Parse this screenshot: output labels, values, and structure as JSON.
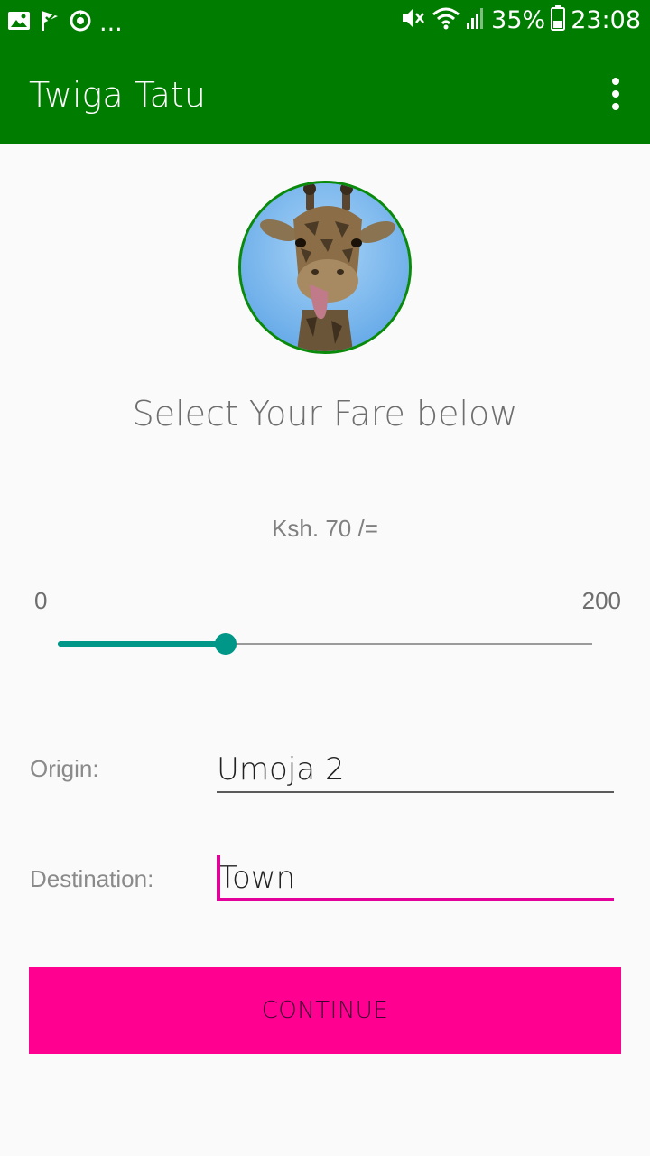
{
  "status_bar": {
    "left_icons": [
      "gallery-icon",
      "checkmark-flag-icon",
      "sync-icon",
      "more-notifications-icon"
    ],
    "more_text": "...",
    "right_icons": [
      "mute-icon",
      "wifi-icon",
      "signal-icon",
      "battery-icon"
    ],
    "battery": "35%",
    "time": "23:08"
  },
  "app_bar": {
    "title": "Twiga Tatu",
    "menu_icon": "overflow-menu-icon"
  },
  "avatar": {
    "icon": "giraffe-avatar",
    "border_color": "#0a8a0a"
  },
  "heading": "Select Your Fare below",
  "fare": {
    "display": "Ksh. 70 /=",
    "min_label": "0",
    "max_label": "200",
    "min": 0,
    "max": 200,
    "value": 63
  },
  "form": {
    "origin_label": "Origin:",
    "origin_value": "Umoja 2",
    "destination_label": "Destination:",
    "destination_value": "Town"
  },
  "continue_label": "CONTINUE",
  "colors": {
    "primary": "#007c00",
    "accent": "#ff0090",
    "slider": "#009688",
    "focus_underline": "#e4009a"
  }
}
